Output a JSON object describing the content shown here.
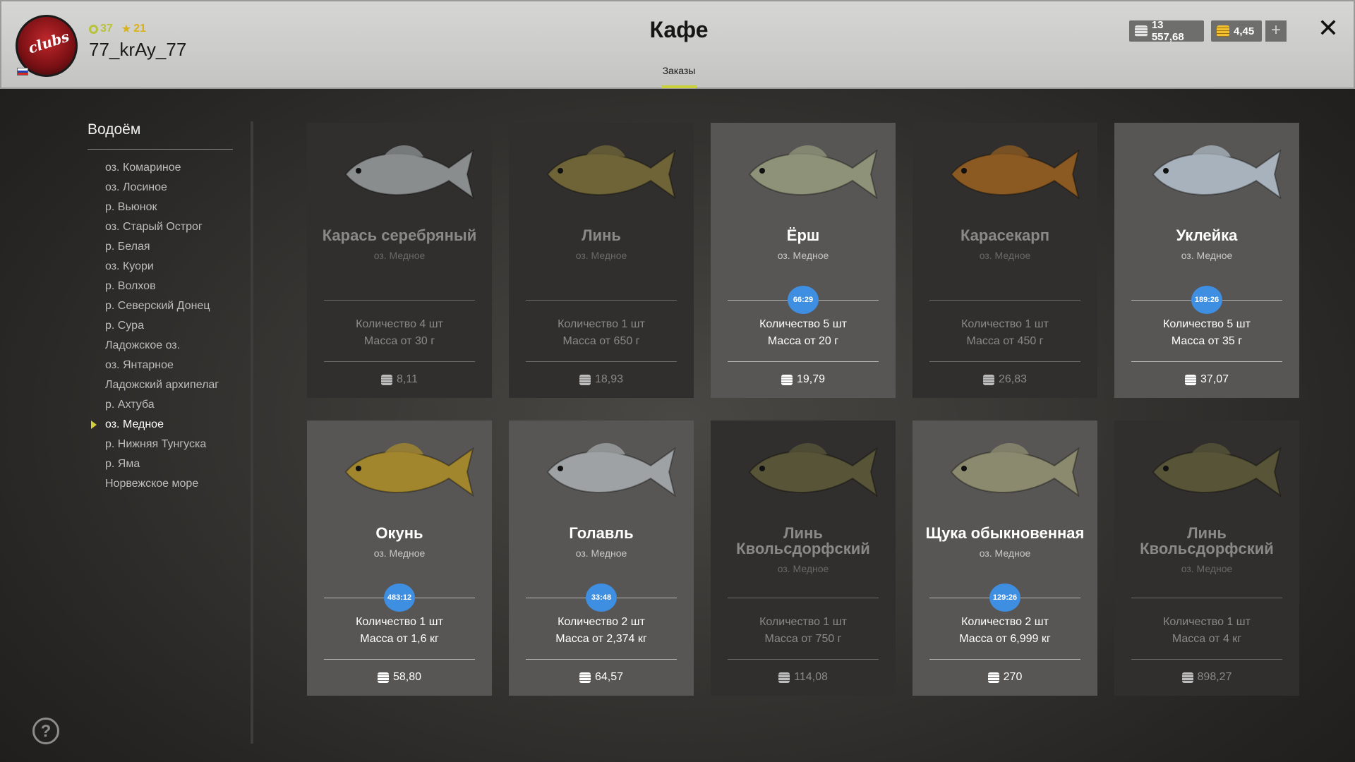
{
  "header": {
    "title": "Кафе",
    "tab_orders": "Заказы",
    "player": {
      "level": "37",
      "stars": "21",
      "username": "77_krAy_77"
    },
    "silver": "13 557,68",
    "gold": "4,45",
    "plus": "+",
    "close": "✕"
  },
  "sidebar": {
    "title": "Водоём",
    "items": [
      {
        "label": "оз. Комариное"
      },
      {
        "label": "оз. Лосиное"
      },
      {
        "label": "р. Вьюнок"
      },
      {
        "label": "оз. Старый Острог"
      },
      {
        "label": "р. Белая"
      },
      {
        "label": "оз. Куори"
      },
      {
        "label": "р. Волхов"
      },
      {
        "label": "р. Северский Донец"
      },
      {
        "label": "р. Сура"
      },
      {
        "label": "Ладожское оз."
      },
      {
        "label": "оз. Янтарное"
      },
      {
        "label": "Ладожский архипелаг"
      },
      {
        "label": "р. Ахтуба"
      },
      {
        "label": "оз. Медное",
        "active": true
      },
      {
        "label": "р. Нижняя Тунгуска"
      },
      {
        "label": "р. Яма"
      },
      {
        "label": "Норвежское море"
      }
    ],
    "help": "?"
  },
  "cards": [
    {
      "name": "Карась серебряный",
      "location": "оз. Медное",
      "quantity": "Количество 4 шт",
      "mass": "Масса от 30 г",
      "price": "8,11",
      "timer": "",
      "highlight": false,
      "fish_color": "#8a8d8e"
    },
    {
      "name": "Линь",
      "location": "оз. Медное",
      "quantity": "Количество 1 шт",
      "mass": "Масса от 650 г",
      "price": "18,93",
      "timer": "",
      "highlight": false,
      "fish_color": "#6e6438"
    },
    {
      "name": "Ёрш",
      "location": "оз. Медное",
      "quantity": "Количество 5 шт",
      "mass": "Масса от 20 г",
      "price": "19,79",
      "timer": "66:29",
      "highlight": true,
      "fish_color": "#8e9278"
    },
    {
      "name": "Карасекарп",
      "location": "оз. Медное",
      "quantity": "Количество 1 шт",
      "mass": "Масса от 450 г",
      "price": "26,83",
      "timer": "",
      "highlight": false,
      "fish_color": "#8a5a22"
    },
    {
      "name": "Уклейка",
      "location": "оз. Медное",
      "quantity": "Количество 5 шт",
      "mass": "Масса от 35 г",
      "price": "37,07",
      "timer": "189:26",
      "highlight": true,
      "fish_color": "#a8b2bc"
    },
    {
      "name": "Окунь",
      "location": "оз. Медное",
      "quantity": "Количество 1 шт",
      "mass": "Масса от 1,6 кг",
      "price": "58,80",
      "timer": "483:12",
      "highlight": true,
      "fish_color": "#a2862e"
    },
    {
      "name": "Голавль",
      "location": "оз. Медное",
      "quantity": "Количество 2 шт",
      "mass": "Масса от 2,374 кг",
      "price": "64,57",
      "timer": "33:48",
      "highlight": true,
      "fish_color": "#9ea2a4"
    },
    {
      "name": "Линь Квольсдорфский",
      "location": "оз. Медное",
      "quantity": "Количество 1 шт",
      "mass": "Масса от 750 г",
      "price": "114,08",
      "timer": "",
      "highlight": false,
      "fish_color": "#585438"
    },
    {
      "name": "Щука обыкновенная",
      "location": "оз. Медное",
      "quantity": "Количество 2 шт",
      "mass": "Масса от 6,999 кг",
      "price": "270",
      "timer": "129:26",
      "highlight": true,
      "fish_color": "#8c8a6e"
    },
    {
      "name": "Линь Квольсдорфский",
      "location": "оз. Медное",
      "quantity": "Количество 1 шт",
      "mass": "Масса от 4 кг",
      "price": "898,27",
      "timer": "",
      "highlight": false,
      "fish_color": "#585438"
    }
  ]
}
